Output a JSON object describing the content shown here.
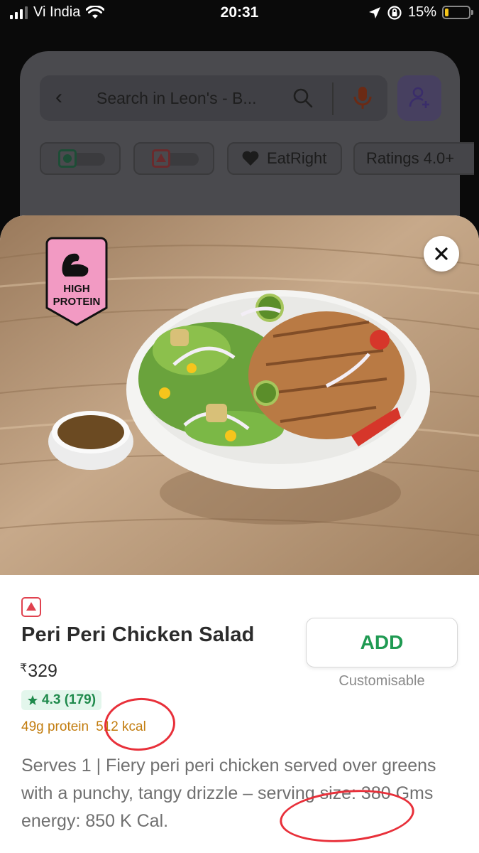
{
  "status_bar": {
    "carrier": "Vi India",
    "time": "20:31",
    "battery_percent": "15%",
    "battery_level": 0.15
  },
  "background": {
    "search_placeholder": "Search in Leon's - B...",
    "filters": [
      {
        "label": ""
      },
      {
        "label": ""
      },
      {
        "label": "EatRight"
      },
      {
        "label": "Ratings 4.0+"
      }
    ]
  },
  "item": {
    "badge_text_1": "HIGH",
    "badge_text_2": "PROTEIN",
    "name": "Peri Peri Chicken Salad",
    "currency": "₹",
    "price": "329",
    "rating": "4.3 (179)",
    "protein": "49g protein",
    "kcal": "512 kcal",
    "add_label": "ADD",
    "customisable_label": "Customisable",
    "description": "Serves 1 | Fiery peri peri chicken served over greens with a punchy, tangy drizzle – serving size: 380 Gms energy: 850 K Cal."
  },
  "colors": {
    "accent_green": "#1f9a52",
    "nonveg_red": "#e0424f",
    "macro_orange": "#c27c0e",
    "annotation_red": "#e8303a",
    "badge_pink": "#f29ac3"
  }
}
